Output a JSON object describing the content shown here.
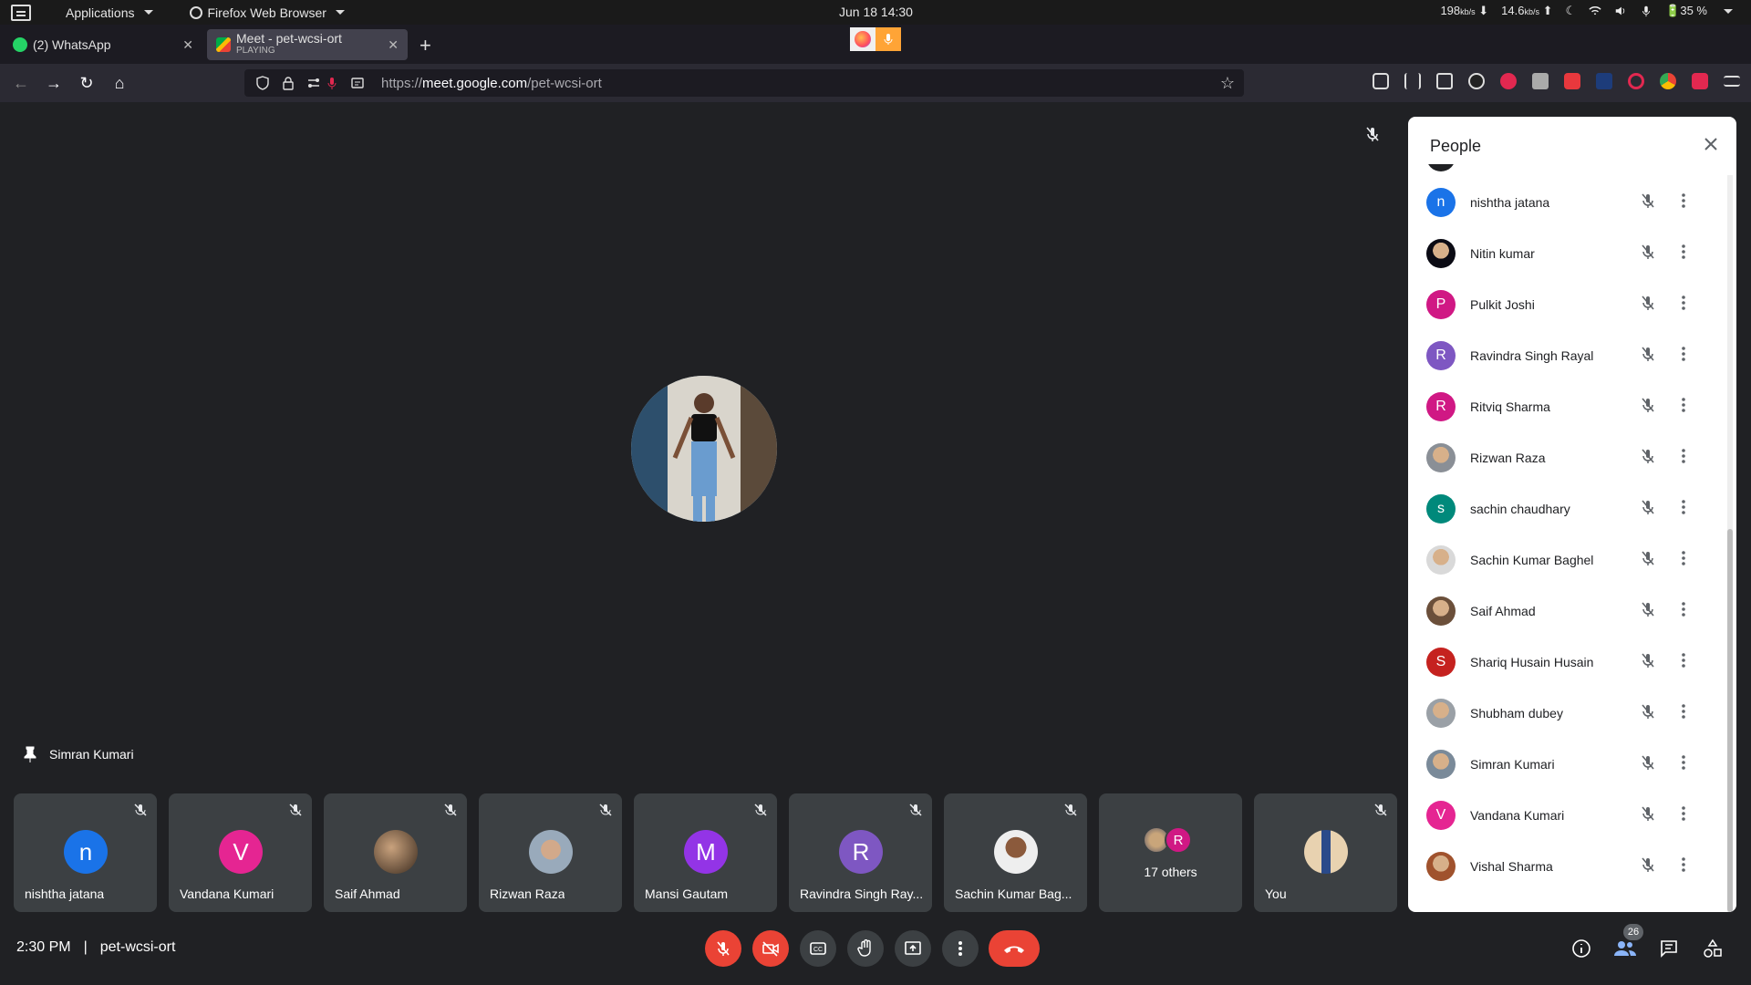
{
  "os": {
    "applications_label": "Applications",
    "browser_label": "Firefox Web Browser",
    "clock": "Jun 18  14:30",
    "down_rate": "198",
    "down_unit": "kb/s",
    "up_rate": "14.6",
    "up_unit": "kb/s",
    "battery": "35 %"
  },
  "tabs": [
    {
      "title": "(2) WhatsApp",
      "subtitle": ""
    },
    {
      "title": "Meet - pet-wcsi-ort",
      "subtitle": "PLAYING"
    }
  ],
  "nav": {
    "url_prefix": "https://",
    "url_host": "meet.google.com",
    "url_path": "/pet-wcsi-ort"
  },
  "meet": {
    "pinned_name": "Simran Kumari",
    "time": "2:30 PM",
    "separator": "|",
    "meeting_code": "pet-wcsi-ort",
    "people_count": "26"
  },
  "tiles": [
    {
      "name": "nishtha jatana",
      "initial": "n",
      "color": "#1a73e8"
    },
    {
      "name": "Vandana Kumari",
      "initial": "V",
      "color": "#e52592"
    },
    {
      "name": "Saif Ahmad",
      "initial": "",
      "color": "#6b4f3a"
    },
    {
      "name": "Rizwan Raza",
      "initial": "",
      "color": "#8a8f96"
    },
    {
      "name": "Mansi Gautam",
      "initial": "M",
      "color": "#9334e6"
    },
    {
      "name": "Ravindra Singh Ray...",
      "initial": "R",
      "color": "#7e57c2"
    },
    {
      "name": "Sachin Kumar Bag...",
      "initial": "",
      "color": "#d9d9d9"
    },
    {
      "name": "You",
      "initial": "",
      "color": "#c9a57a"
    }
  ],
  "others_tile": {
    "label": "17 others",
    "initial": "R"
  },
  "panel": {
    "title": "People",
    "people": [
      {
        "name": "nishtha jatana",
        "initial": "n",
        "color": "#1a73e8"
      },
      {
        "name": "Nitin kumar",
        "initial": "",
        "color": "#0b0b14"
      },
      {
        "name": "Pulkit Joshi",
        "initial": "P",
        "color": "#d01884"
      },
      {
        "name": "Ravindra Singh Rayal",
        "initial": "R",
        "color": "#7e57c2"
      },
      {
        "name": "Ritviq Sharma",
        "initial": "R",
        "color": "#d01884"
      },
      {
        "name": "Rizwan Raza",
        "initial": "",
        "color": "#8a8f96"
      },
      {
        "name": "sachin chaudhary",
        "initial": "s",
        "color": "#00897b"
      },
      {
        "name": "Sachin Kumar Baghel",
        "initial": "",
        "color": "#d9d9d9"
      },
      {
        "name": "Saif Ahmad",
        "initial": "",
        "color": "#6b4f3a"
      },
      {
        "name": "Shariq Husain Husain",
        "initial": "S",
        "color": "#c5221f"
      },
      {
        "name": "Shubham dubey",
        "initial": "",
        "color": "#9aa0a6"
      },
      {
        "name": "Simran Kumari",
        "initial": "",
        "color": "#7a8a99"
      },
      {
        "name": "Vandana Kumari",
        "initial": "V",
        "color": "#e52592"
      },
      {
        "name": "Vishal Sharma",
        "initial": "",
        "color": "#a0522d"
      }
    ]
  }
}
